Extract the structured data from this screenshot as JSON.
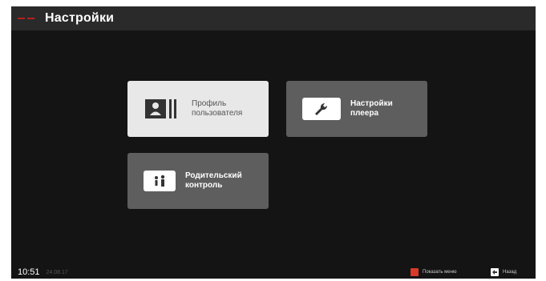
{
  "header": {
    "title": "Настройки"
  },
  "tiles": [
    {
      "label": "Профиль\nпользователя",
      "icon": "user-profile-icon",
      "state": "selected"
    },
    {
      "label": "Настройки\nплеера",
      "icon": "wrench-icon",
      "state": "normal"
    },
    {
      "label": "Родительский\nконтроль",
      "icon": "parental-family-icon",
      "state": "normal"
    }
  ],
  "footer": {
    "time": "10:51",
    "date": "24.08.17",
    "hint_menu": "Показать меню",
    "hint_back": "Назад"
  },
  "colors": {
    "accent_red": "#d83a2a",
    "background": "#141414",
    "topbar": "#2a2a2a",
    "tile_selected": "#e8e8e8",
    "tile_normal": "#5e5e5e"
  }
}
